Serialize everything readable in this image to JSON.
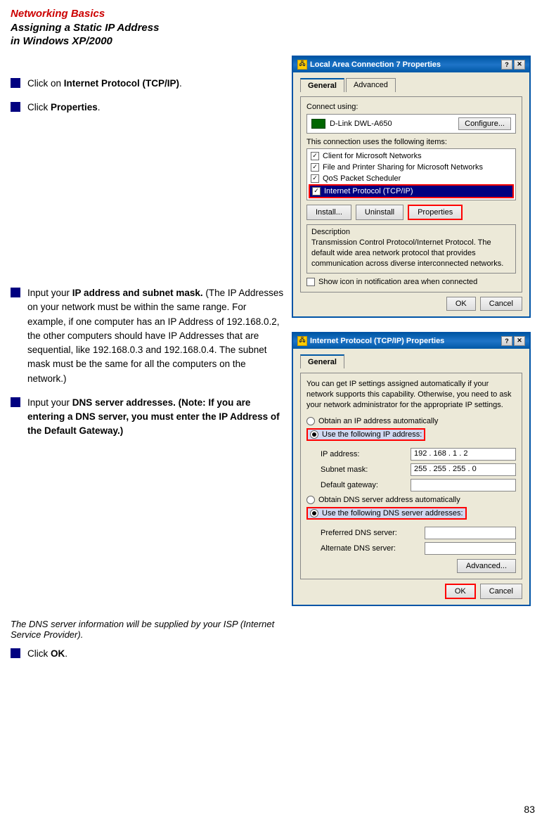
{
  "header": {
    "title": "Networking Basics",
    "subtitle_line1": "Assigning a Static IP Address",
    "subtitle_line2": "in Windows XP/2000"
  },
  "bullets": [
    {
      "id": "bullet1",
      "text_before": "Click on ",
      "bold_text": "Internet Protocol (TCP/IP)",
      "text_after": "."
    },
    {
      "id": "bullet2",
      "text_before": "Click ",
      "bold_text": "Properties",
      "text_after": "."
    },
    {
      "id": "bullet3",
      "text_before": "Input your ",
      "bold_text": "IP address and subnet mask.",
      "text_after": " (The IP Addresses on your network must be within the same range. For example, if one computer has an IP Address of 192.168.0.2, the other computers should have IP Addresses that are sequential, like 192.168.0.3 and 192.168.0.4. The subnet mask must be the same for all the computers on the network.)"
    },
    {
      "id": "bullet4",
      "text_before": "Input your ",
      "bold_text": "DNS server addresses. (Note:  If you are entering a DNS server, you must enter the IP Address of the Default Gateway.)"
    }
  ],
  "footer_note": "The DNS server information will be supplied by your ISP (Internet Service Provider).",
  "bullet_ok": {
    "text_before": "Click ",
    "bold_text": "OK",
    "text_after": "."
  },
  "page_number": "83",
  "dialog1": {
    "title": "Local Area Connection 7 Properties",
    "tab_general": "General",
    "tab_advanced": "Advanced",
    "connect_using_label": "Connect using:",
    "nic_name": "D-Link DWL-A650",
    "configure_btn": "Configure...",
    "items_label": "This connection uses the following items:",
    "items": [
      {
        "checked": true,
        "label": "Client for Microsoft Networks"
      },
      {
        "checked": true,
        "label": "File and Printer Sharing for Microsoft Networks"
      },
      {
        "checked": true,
        "label": "QoS Packet Scheduler"
      },
      {
        "checked": true,
        "label": "Internet Protocol (TCP/IP)",
        "highlighted": true
      }
    ],
    "install_btn": "Install...",
    "uninstall_btn": "Uninstall",
    "properties_btn": "Properties",
    "description_label": "Description",
    "description_text": "Transmission Control Protocol/Internet Protocol. The default wide area network protocol that provides communication across diverse interconnected networks.",
    "show_icon_label": "Show icon in notification area when connected",
    "ok_btn": "OK",
    "cancel_btn": "Cancel"
  },
  "dialog2": {
    "title": "Internet Protocol (TCP/IP) Properties",
    "tab_general": "General",
    "intro_text": "You can get IP settings assigned automatically if your network supports this capability. Otherwise, you need to ask your network administrator for the appropriate IP settings.",
    "radio_auto": "Obtain an IP address automatically",
    "radio_use": "Use the following IP address:",
    "ip_address_label": "IP address:",
    "ip_address_value": "192 . 168 . 1 . 2",
    "subnet_label": "Subnet mask:",
    "subnet_value": "255 . 255 . 255 . 0",
    "gateway_label": "Default gateway:",
    "gateway_value": "",
    "radio_dns_auto": "Obtain DNS server address automatically",
    "radio_dns_use": "Use the following DNS server addresses:",
    "preferred_dns_label": "Preferred DNS server:",
    "preferred_dns_value": "",
    "alternate_dns_label": "Alternate DNS server:",
    "alternate_dns_value": "",
    "advanced_btn": "Advanced...",
    "ok_btn": "OK",
    "cancel_btn": "Cancel"
  }
}
